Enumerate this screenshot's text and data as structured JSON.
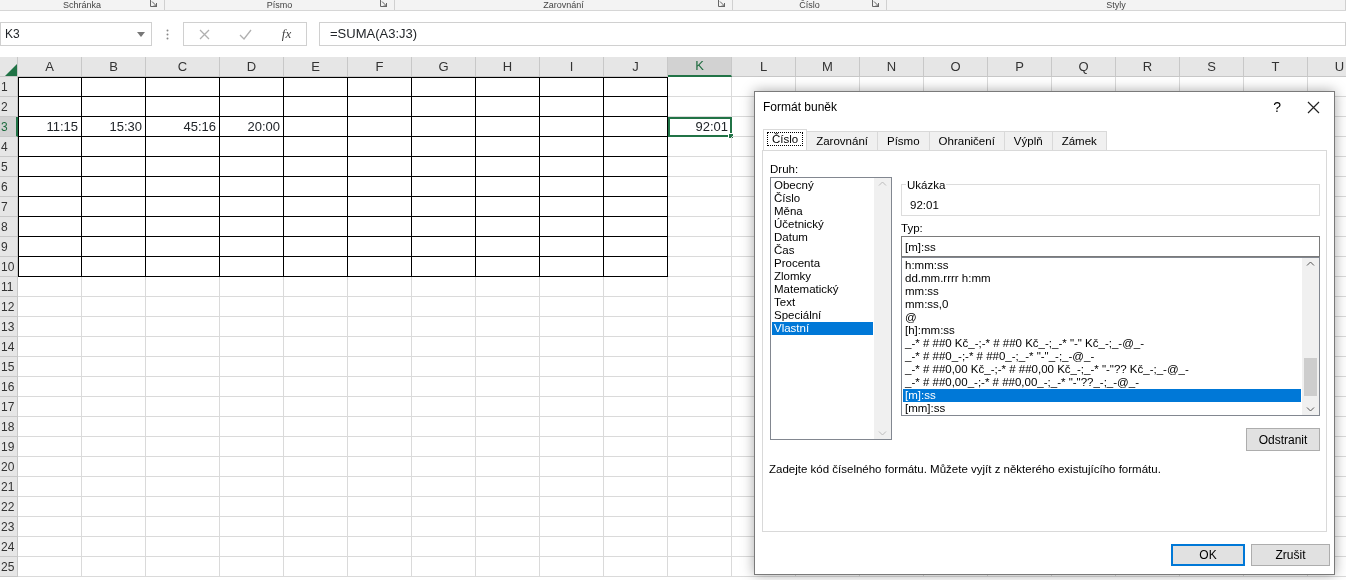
{
  "ribbon_groups": [
    "Schránka",
    "Písmo",
    "Zarovnání",
    "Číslo",
    "Styly"
  ],
  "formula_bar": {
    "name_box": "K3",
    "function_label": "fx",
    "formula": "=SUMA(A3:J3)"
  },
  "sheet": {
    "columns": [
      {
        "label": "A",
        "selected": false,
        "bordered": true
      },
      {
        "label": "B",
        "selected": false,
        "bordered": true
      },
      {
        "label": "C",
        "selected": false,
        "bordered": true
      },
      {
        "label": "D",
        "selected": false,
        "bordered": true
      },
      {
        "label": "E",
        "selected": false,
        "bordered": true
      },
      {
        "label": "F",
        "selected": false,
        "bordered": true
      },
      {
        "label": "G",
        "selected": false,
        "bordered": true
      },
      {
        "label": "H",
        "selected": false,
        "bordered": true
      },
      {
        "label": "I",
        "selected": false,
        "bordered": true
      },
      {
        "label": "J",
        "selected": false,
        "bordered": true
      },
      {
        "label": "K",
        "selected": true,
        "bordered": false
      },
      {
        "label": "L",
        "selected": false,
        "bordered": false
      },
      {
        "label": "M",
        "selected": false,
        "bordered": false
      },
      {
        "label": "N",
        "selected": false,
        "bordered": false
      },
      {
        "label": "O",
        "selected": false,
        "bordered": false
      },
      {
        "label": "P",
        "selected": false,
        "bordered": false
      },
      {
        "label": "Q",
        "selected": false,
        "bordered": false
      },
      {
        "label": "R",
        "selected": false,
        "bordered": false
      },
      {
        "label": "S",
        "selected": false,
        "bordered": false
      },
      {
        "label": "T",
        "selected": false,
        "bordered": false
      },
      {
        "label": "U",
        "selected": false,
        "bordered": false
      }
    ],
    "rows": [
      {
        "number": "1",
        "selected": false,
        "bordered": true
      },
      {
        "number": "2",
        "selected": false,
        "bordered": true
      },
      {
        "number": "3",
        "selected": true,
        "bordered": true,
        "cells": [
          {
            "value": "11:15"
          },
          {
            "value": "15:30"
          },
          {
            "value": "45:16"
          },
          {
            "value": "20:00"
          },
          {},
          {},
          {},
          {},
          {},
          {},
          {
            "value": "92:01"
          }
        ]
      },
      {
        "number": "4",
        "selected": false,
        "bordered": true
      },
      {
        "number": "5",
        "selected": false,
        "bordered": true
      },
      {
        "number": "6",
        "selected": false,
        "bordered": true
      },
      {
        "number": "7",
        "selected": false,
        "bordered": true
      },
      {
        "number": "8",
        "selected": false,
        "bordered": true
      },
      {
        "number": "9",
        "selected": false,
        "bordered": true
      },
      {
        "number": "10",
        "selected": false,
        "bordered": true
      },
      {
        "number": "11",
        "selected": false,
        "bordered": false
      },
      {
        "number": "12",
        "selected": false,
        "bordered": false
      },
      {
        "number": "13",
        "selected": false,
        "bordered": false
      },
      {
        "number": "14",
        "selected": false,
        "bordered": false
      },
      {
        "number": "15",
        "selected": false,
        "bordered": false
      },
      {
        "number": "16",
        "selected": false,
        "bordered": false
      },
      {
        "number": "17",
        "selected": false,
        "bordered": false
      },
      {
        "number": "18",
        "selected": false,
        "bordered": false
      },
      {
        "number": "19",
        "selected": false,
        "bordered": false
      },
      {
        "number": "20",
        "selected": false,
        "bordered": false
      },
      {
        "number": "21",
        "selected": false,
        "bordered": false
      },
      {
        "number": "22",
        "selected": false,
        "bordered": false
      },
      {
        "number": "23",
        "selected": false,
        "bordered": false
      },
      {
        "number": "24",
        "selected": false,
        "bordered": false
      },
      {
        "number": "25",
        "selected": false,
        "bordered": false
      }
    ]
  },
  "dialog": {
    "title": "Formát buněk",
    "help": "?",
    "tabs": [
      {
        "label": "Číslo",
        "selected": true
      },
      {
        "label": "Zarovnání",
        "selected": false
      },
      {
        "label": "Písmo",
        "selected": false
      },
      {
        "label": "Ohraničení",
        "selected": false
      },
      {
        "label": "Výplň",
        "selected": false
      },
      {
        "label": "Zámek",
        "selected": false
      }
    ],
    "category_label": "Druh:",
    "categories": [
      {
        "label": "Obecný",
        "selected": false
      },
      {
        "label": "Číslo",
        "selected": false
      },
      {
        "label": "Měna",
        "selected": false
      },
      {
        "label": "Účetnický",
        "selected": false
      },
      {
        "label": "Datum",
        "selected": false
      },
      {
        "label": "Čas",
        "selected": false
      },
      {
        "label": "Procenta",
        "selected": false
      },
      {
        "label": "Zlomky",
        "selected": false
      },
      {
        "label": "Matematický",
        "selected": false
      },
      {
        "label": "Text",
        "selected": false
      },
      {
        "label": "Speciální",
        "selected": false
      },
      {
        "label": "Vlastní",
        "selected": true
      }
    ],
    "sample_label": "Ukázka",
    "sample_value": "92:01",
    "type_label": "Typ:",
    "type_value": "[m]:ss",
    "formats": [
      {
        "label": "h:mm:ss",
        "selected": false
      },
      {
        "label": "dd.mm.rrrr h:mm",
        "selected": false
      },
      {
        "label": "mm:ss",
        "selected": false
      },
      {
        "label": "mm:ss,0",
        "selected": false
      },
      {
        "label": "@",
        "selected": false
      },
      {
        "label": "[h]:mm:ss",
        "selected": false
      },
      {
        "label": "_-* # ##0 Kč_-;-* # ##0 Kč_-;_-* \"-\" Kč_-;_-@_-",
        "selected": false
      },
      {
        "label": "_-* # ##0_-;-* # ##0_-;_-* \"-\"_-;_-@_-",
        "selected": false
      },
      {
        "label": "_-* # ##0,00 Kč_-;-* # ##0,00 Kč_-;_-* \"-\"?? Kč_-;_-@_-",
        "selected": false
      },
      {
        "label": "_-* # ##0,00_-;-* # ##0,00_-;_-* \"-\"??_-;_-@_-",
        "selected": false
      },
      {
        "label": "[m]:ss",
        "selected": true
      },
      {
        "label": "[mm]:ss",
        "selected": false
      }
    ],
    "delete_button": "Odstranit",
    "hint": "Zadejte kód číselného formátu. Můžete vyjít z některého existujícího formátu.",
    "ok_button": "OK",
    "cancel_button": "Zrušit"
  }
}
